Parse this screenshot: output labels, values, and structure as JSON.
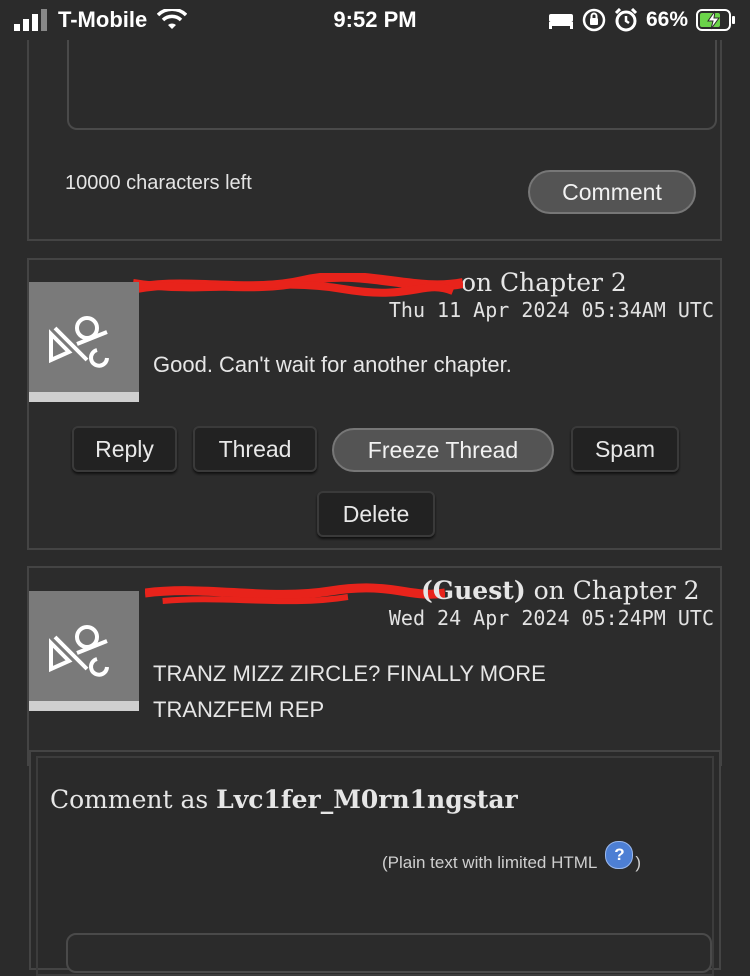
{
  "status_bar": {
    "carrier": "T-Mobile",
    "time": "9:52 PM",
    "battery": "66%"
  },
  "top_form": {
    "chars_left": "10000 characters left",
    "comment_button": "Comment"
  },
  "comments": [
    {
      "author_suffix": "on Chapter 2",
      "date": "Thu 11 Apr 2024 05:34AM UTC",
      "body": "Good. Can't wait for another chapter.",
      "actions": {
        "reply": "Reply",
        "thread": "Thread",
        "freeze": "Freeze Thread",
        "spam": "Spam",
        "delete": "Delete"
      }
    },
    {
      "author_visible": "(Guest)",
      "author_suffix": "on Chapter 2",
      "date": "Wed 24 Apr 2024 05:24PM UTC",
      "body_line1": "TRANZ MIZZ ZIRCLE? FINALLY MORE",
      "body_line2": "TRANZFEM REP"
    }
  ],
  "reply_form": {
    "comment_as_prefix": "Comment as",
    "username": "Lvc1fer_M0rn1ngstar",
    "plain_note": "(Plain text with limited HTML",
    "plain_note_close": ")",
    "help_glyph": "?"
  }
}
